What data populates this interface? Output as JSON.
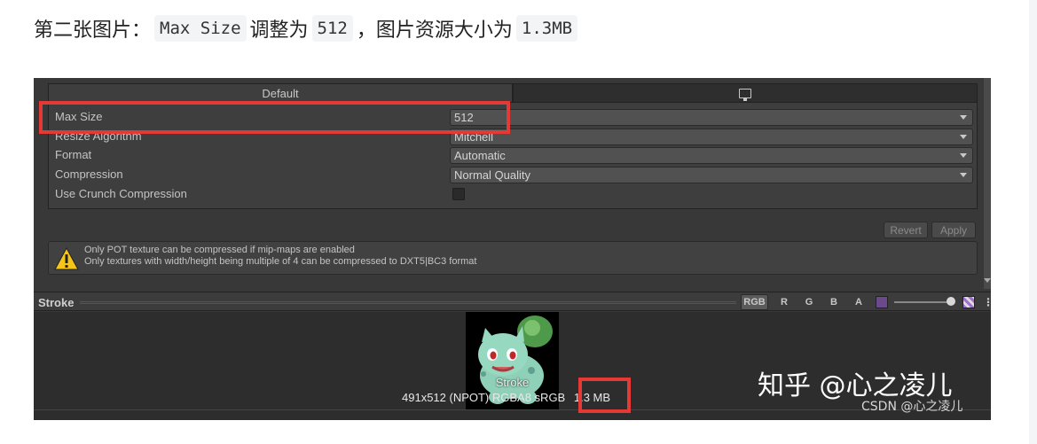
{
  "article": {
    "heading_prefix": "第二张图片：",
    "code_max_size": "Max Size",
    "mid_text": "调整为",
    "code_512": "512",
    "comma": "，",
    "tail_text": "图片资源大小为",
    "code_size": "1.3MB"
  },
  "inspector": {
    "tabs": [
      {
        "label": "Default",
        "icon": ""
      },
      {
        "label": "",
        "icon": "monitor-icon"
      }
    ],
    "rows": [
      {
        "label": "Max Size",
        "value": "512"
      },
      {
        "label": "Resize Algorithm",
        "value": "Mitchell"
      },
      {
        "label": "Format",
        "value": "Automatic"
      },
      {
        "label": "Compression",
        "value": "Normal Quality"
      },
      {
        "label": "Use Crunch Compression",
        "checked": false
      }
    ],
    "buttons": {
      "revert": "Revert",
      "apply": "Apply"
    },
    "warning": {
      "icon": "warning-triangle-icon",
      "line1": "Only POT texture can be compressed if mip-maps are enabled",
      "line2": "Only textures with width/height being multiple of 4 can be compressed to DXT5|BC3 format"
    }
  },
  "preview": {
    "title": "Stroke",
    "channels": [
      "RGB",
      "R",
      "G",
      "B",
      "A"
    ],
    "thumb_label": "Stroke",
    "info_main": "491x512 (NPOT)  RGBA8 sRGB",
    "info_size": "1.3 MB"
  },
  "watermarks": {
    "zhihu": "知乎 @心之凌儿",
    "csdn": "CSDN @心之凌儿"
  },
  "colors": {
    "highlight": "#e53935",
    "editor_bg": "#383838"
  }
}
